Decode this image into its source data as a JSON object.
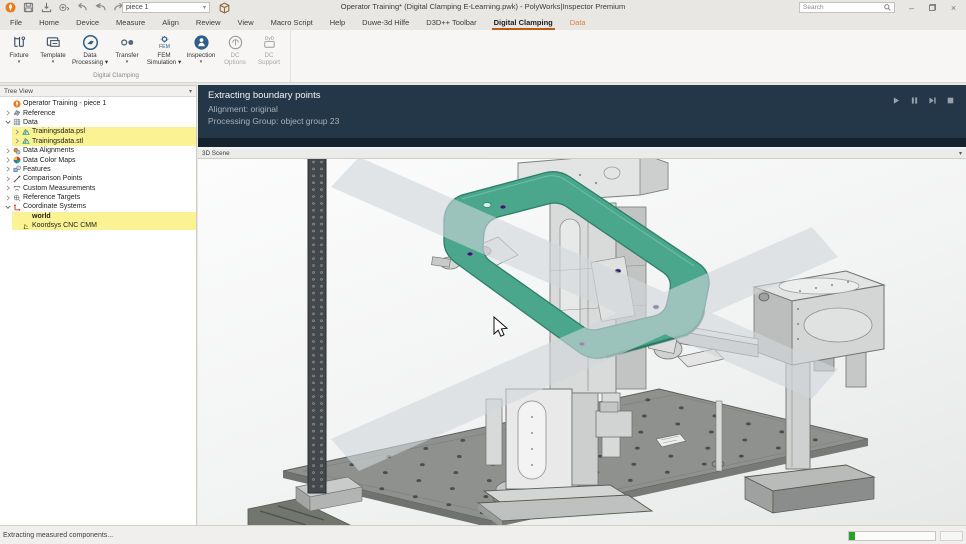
{
  "colors": {
    "accent_orange": "#ee7b17",
    "menu_underline": "#c05a17",
    "message_panel_navy": "#243748",
    "tree_highlight_yellow": "#faf293",
    "part_green": "#4aa78c",
    "progress_green": "#27a12d"
  },
  "window": {
    "title": "Operator Training* (Digital Clamping E-Learning.pwk) - PolyWorks|Inspector Premium",
    "search_placeholder": "Search",
    "piece_selector_value": "piece 1",
    "quick_access_icons": [
      "polyworks-logo",
      "save-icon",
      "import-icon",
      "mail-icon",
      "undo-icon",
      "undo-double-icon",
      "redo-icon"
    ],
    "controls": [
      "minimize",
      "maximize",
      "close"
    ]
  },
  "menubar": {
    "items": [
      {
        "label": "File"
      },
      {
        "label": "Home"
      },
      {
        "label": "Device"
      },
      {
        "label": "Measure"
      },
      {
        "label": "Align"
      },
      {
        "label": "Review"
      },
      {
        "label": "View"
      },
      {
        "label": "Macro Script"
      },
      {
        "label": "Help"
      },
      {
        "label": "Duwe-3d Hilfe"
      },
      {
        "label": "D3D++ Toolbar"
      },
      {
        "label": "Digital Clamping",
        "active": true
      },
      {
        "label": "Data",
        "highlighted": true
      }
    ]
  },
  "ribbon": {
    "group_label": "Digital Clamping",
    "buttons": [
      {
        "label": "Fixture",
        "line1": "Fixture",
        "line2": "",
        "icon": "fixture-icon",
        "caret": "below",
        "enabled": true,
        "wide": false
      },
      {
        "label": "Template",
        "line1": "Template",
        "line2": "",
        "icon": "template-icon",
        "caret": "below",
        "enabled": true,
        "wide": false
      },
      {
        "label": "Data Processing",
        "line1": "Data",
        "line2": "Processing",
        "icon": "data-processing-icon",
        "caret": "inline",
        "enabled": true,
        "wide": true
      },
      {
        "label": "Transfer",
        "line1": "Transfer",
        "line2": "",
        "icon": "transfer-icon",
        "caret": "below",
        "enabled": true,
        "wide": false
      },
      {
        "label": "FEM Simulation",
        "line1": "FEM",
        "line2": "Simulation",
        "icon": "fem-simulation-icon",
        "caret": "inline",
        "enabled": true,
        "wide": true
      },
      {
        "label": "Inspection",
        "line1": "Inspection",
        "line2": "",
        "icon": "inspection-icon",
        "caret": "below",
        "enabled": true,
        "wide": false
      },
      {
        "label": "DC Options",
        "line1": "DC",
        "line2": "Options",
        "icon": "dc-options-icon",
        "caret": "none",
        "enabled": false,
        "wide": false
      },
      {
        "label": "DC Support",
        "line1": "DC",
        "line2": "Support",
        "icon": "dc-support-icon",
        "caret": "none",
        "enabled": false,
        "wide": false
      }
    ]
  },
  "tree": {
    "header": "Tree View",
    "items": [
      {
        "label": "Operator Training - piece 1",
        "indent": 0,
        "expander": "none",
        "icon": "polyworks-small",
        "highlight": false,
        "bold": false
      },
      {
        "label": "Reference",
        "indent": 0,
        "expander": "collapsed",
        "icon": "reference-icon",
        "highlight": false,
        "bold": false
      },
      {
        "label": "Data",
        "indent": 0,
        "expander": "expanded",
        "icon": "data-grid-icon",
        "highlight": false,
        "bold": false
      },
      {
        "label": "Trainingsdata.psl",
        "indent": 1,
        "expander": "collapsed",
        "icon": "mesh-icon",
        "highlight": true,
        "bold": false
      },
      {
        "label": "Trainingsdata.stl",
        "indent": 1,
        "expander": "collapsed",
        "icon": "mesh-icon",
        "highlight": true,
        "bold": false
      },
      {
        "label": "Data Alignments",
        "indent": 0,
        "expander": "collapsed",
        "icon": "alignments-icon",
        "highlight": false,
        "bold": false
      },
      {
        "label": "Data Color Maps",
        "indent": 0,
        "expander": "collapsed",
        "icon": "colormap-icon",
        "highlight": false,
        "bold": false
      },
      {
        "label": "Features",
        "indent": 0,
        "expander": "collapsed",
        "icon": "features-icon",
        "highlight": false,
        "bold": false
      },
      {
        "label": "Comparison Points",
        "indent": 0,
        "expander": "collapsed",
        "icon": "comparison-icon",
        "highlight": false,
        "bold": false
      },
      {
        "label": "Custom Measurements",
        "indent": 0,
        "expander": "collapsed",
        "icon": "measurement-icon",
        "highlight": false,
        "bold": false
      },
      {
        "label": "Reference Targets",
        "indent": 0,
        "expander": "collapsed",
        "icon": "targets-icon",
        "highlight": false,
        "bold": false
      },
      {
        "label": "Coordinate Systems",
        "indent": 0,
        "expander": "expanded",
        "icon": "coordsys-icon",
        "highlight": false,
        "bold": false
      },
      {
        "label": "world",
        "indent": 1,
        "expander": "none",
        "icon": "blank",
        "highlight": true,
        "bold": true
      },
      {
        "label": "Koordsys CNC CMM",
        "indent": 1,
        "expander": "none",
        "icon": "coordsys-small-icon",
        "highlight": true,
        "bold": false
      }
    ]
  },
  "message_panel": {
    "title": "Extracting boundary points",
    "line1": "Alignment: original",
    "line2": "Processing Group: object group 23",
    "controls": [
      "play",
      "pause",
      "skip",
      "stop"
    ]
  },
  "scene": {
    "caption": "3D Scene"
  },
  "statusbar": {
    "text": "Extracting measured components...",
    "progress_percent": 7
  }
}
